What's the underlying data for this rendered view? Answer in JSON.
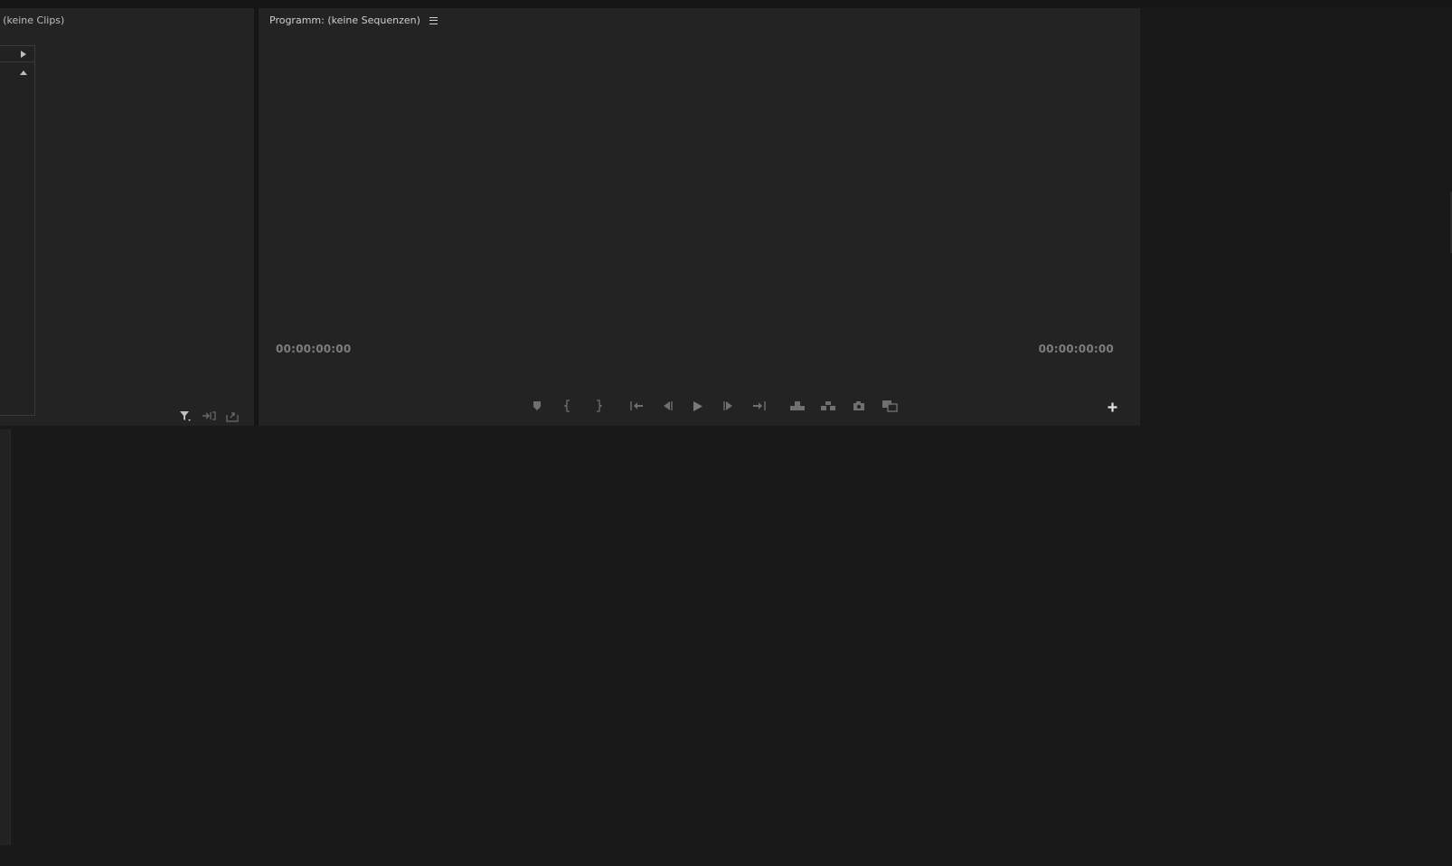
{
  "source_panel": {
    "title": ": (keine Clips)"
  },
  "program_panel": {
    "title": "Programm: (keine Sequenzen)",
    "timecode_in": "00:00:00:00",
    "timecode_out": "00:00:00:00"
  },
  "icons": {
    "menu": "hamburger-menu-icon",
    "marker": "marker-icon",
    "mark_in": "mark-in-icon",
    "mark_out": "mark-out-icon",
    "go_to_in": "go-to-in-icon",
    "step_back": "step-back-icon",
    "play": "play-icon",
    "step_forward": "step-forward-icon",
    "go_to_out": "go-to-out-icon",
    "lift": "lift-icon",
    "extract": "extract-icon",
    "export_frame": "camera-icon",
    "comparison_view": "comparison-view-icon",
    "add": "plus-icon",
    "filter": "filter-icon",
    "insert": "insert-icon",
    "export": "export-icon"
  },
  "colors": {
    "panel_bg": "#232323",
    "app_bg": "#191919",
    "timecode": "#7d7d7d",
    "icon": "#6f6f6f"
  }
}
